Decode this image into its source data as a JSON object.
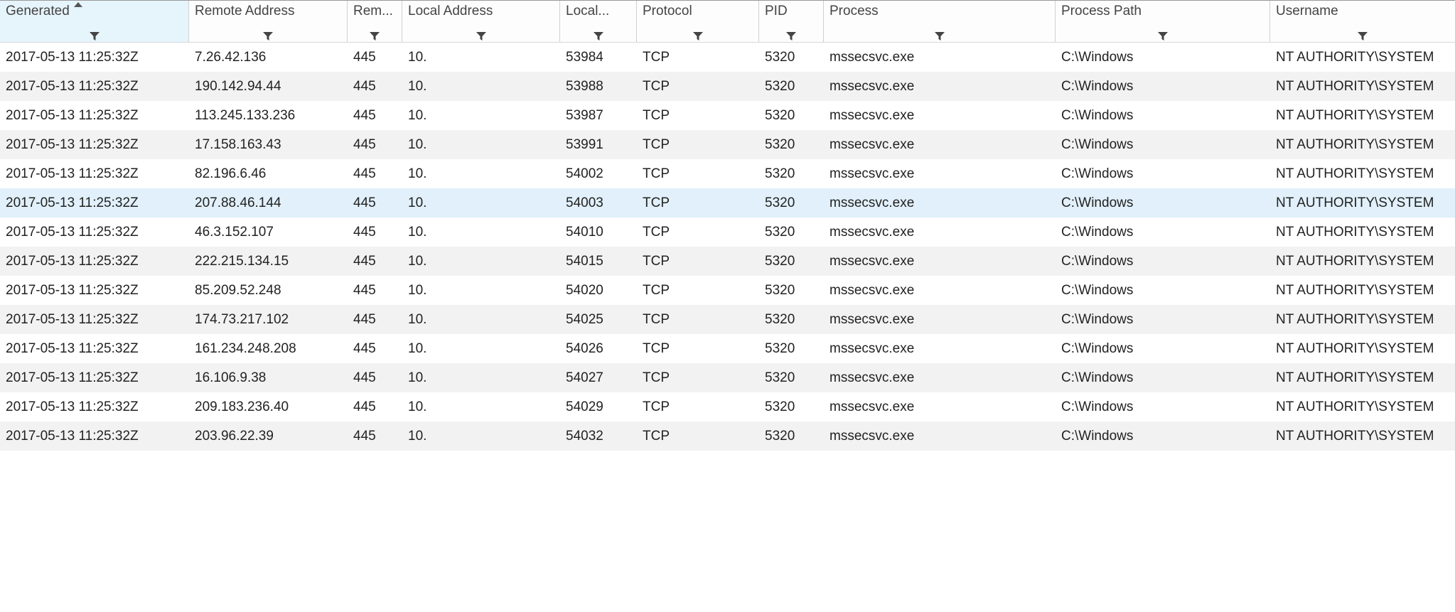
{
  "columns": [
    {
      "key": "generated",
      "label": "Generated",
      "sorted": true
    },
    {
      "key": "remote_addr",
      "label": "Remote Address"
    },
    {
      "key": "remote_port",
      "label": "Rem..."
    },
    {
      "key": "local_addr",
      "label": "Local Address"
    },
    {
      "key": "local_port",
      "label": "Local..."
    },
    {
      "key": "protocol",
      "label": "Protocol"
    },
    {
      "key": "pid",
      "label": "PID"
    },
    {
      "key": "process",
      "label": "Process"
    },
    {
      "key": "process_path",
      "label": "Process Path"
    },
    {
      "key": "username",
      "label": "Username"
    }
  ],
  "selected_index": 5,
  "rows": [
    {
      "generated": "2017-05-13 11:25:32Z",
      "remote_addr": "7.26.42.136",
      "remote_port": "445",
      "local_addr": "10.",
      "local_port": "53984",
      "protocol": "TCP",
      "pid": "5320",
      "process": "mssecsvc.exe",
      "process_path": "C:\\Windows",
      "username": "NT AUTHORITY\\SYSTEM"
    },
    {
      "generated": "2017-05-13 11:25:32Z",
      "remote_addr": "190.142.94.44",
      "remote_port": "445",
      "local_addr": "10.",
      "local_port": "53988",
      "protocol": "TCP",
      "pid": "5320",
      "process": "mssecsvc.exe",
      "process_path": "C:\\Windows",
      "username": "NT AUTHORITY\\SYSTEM"
    },
    {
      "generated": "2017-05-13 11:25:32Z",
      "remote_addr": "113.245.133.236",
      "remote_port": "445",
      "local_addr": "10.",
      "local_port": "53987",
      "protocol": "TCP",
      "pid": "5320",
      "process": "mssecsvc.exe",
      "process_path": "C:\\Windows",
      "username": "NT AUTHORITY\\SYSTEM"
    },
    {
      "generated": "2017-05-13 11:25:32Z",
      "remote_addr": "17.158.163.43",
      "remote_port": "445",
      "local_addr": "10.",
      "local_port": "53991",
      "protocol": "TCP",
      "pid": "5320",
      "process": "mssecsvc.exe",
      "process_path": "C:\\Windows",
      "username": "NT AUTHORITY\\SYSTEM"
    },
    {
      "generated": "2017-05-13 11:25:32Z",
      "remote_addr": "82.196.6.46",
      "remote_port": "445",
      "local_addr": "10.",
      "local_port": "54002",
      "protocol": "TCP",
      "pid": "5320",
      "process": "mssecsvc.exe",
      "process_path": "C:\\Windows",
      "username": "NT AUTHORITY\\SYSTEM"
    },
    {
      "generated": "2017-05-13 11:25:32Z",
      "remote_addr": "207.88.46.144",
      "remote_port": "445",
      "local_addr": "10.",
      "local_port": "54003",
      "protocol": "TCP",
      "pid": "5320",
      "process": "mssecsvc.exe",
      "process_path": "C:\\Windows",
      "username": "NT AUTHORITY\\SYSTEM"
    },
    {
      "generated": "2017-05-13 11:25:32Z",
      "remote_addr": "46.3.152.107",
      "remote_port": "445",
      "local_addr": "10.",
      "local_port": "54010",
      "protocol": "TCP",
      "pid": "5320",
      "process": "mssecsvc.exe",
      "process_path": "C:\\Windows",
      "username": "NT AUTHORITY\\SYSTEM"
    },
    {
      "generated": "2017-05-13 11:25:32Z",
      "remote_addr": "222.215.134.15",
      "remote_port": "445",
      "local_addr": "10.",
      "local_port": "54015",
      "protocol": "TCP",
      "pid": "5320",
      "process": "mssecsvc.exe",
      "process_path": "C:\\Windows",
      "username": "NT AUTHORITY\\SYSTEM"
    },
    {
      "generated": "2017-05-13 11:25:32Z",
      "remote_addr": "85.209.52.248",
      "remote_port": "445",
      "local_addr": "10.",
      "local_port": "54020",
      "protocol": "TCP",
      "pid": "5320",
      "process": "mssecsvc.exe",
      "process_path": "C:\\Windows",
      "username": "NT AUTHORITY\\SYSTEM"
    },
    {
      "generated": "2017-05-13 11:25:32Z",
      "remote_addr": "174.73.217.102",
      "remote_port": "445",
      "local_addr": "10.",
      "local_port": "54025",
      "protocol": "TCP",
      "pid": "5320",
      "process": "mssecsvc.exe",
      "process_path": "C:\\Windows",
      "username": "NT AUTHORITY\\SYSTEM"
    },
    {
      "generated": "2017-05-13 11:25:32Z",
      "remote_addr": "161.234.248.208",
      "remote_port": "445",
      "local_addr": "10.",
      "local_port": "54026",
      "protocol": "TCP",
      "pid": "5320",
      "process": "mssecsvc.exe",
      "process_path": "C:\\Windows",
      "username": "NT AUTHORITY\\SYSTEM"
    },
    {
      "generated": "2017-05-13 11:25:32Z",
      "remote_addr": "16.106.9.38",
      "remote_port": "445",
      "local_addr": "10.",
      "local_port": "54027",
      "protocol": "TCP",
      "pid": "5320",
      "process": "mssecsvc.exe",
      "process_path": "C:\\Windows",
      "username": "NT AUTHORITY\\SYSTEM"
    },
    {
      "generated": "2017-05-13 11:25:32Z",
      "remote_addr": "209.183.236.40",
      "remote_port": "445",
      "local_addr": "10.",
      "local_port": "54029",
      "protocol": "TCP",
      "pid": "5320",
      "process": "mssecsvc.exe",
      "process_path": "C:\\Windows",
      "username": "NT AUTHORITY\\SYSTEM"
    },
    {
      "generated": "2017-05-13 11:25:32Z",
      "remote_addr": "203.96.22.39",
      "remote_port": "445",
      "local_addr": "10.",
      "local_port": "54032",
      "protocol": "TCP",
      "pid": "5320",
      "process": "mssecsvc.exe",
      "process_path": "C:\\Windows",
      "username": "NT AUTHORITY\\SYSTEM"
    }
  ]
}
